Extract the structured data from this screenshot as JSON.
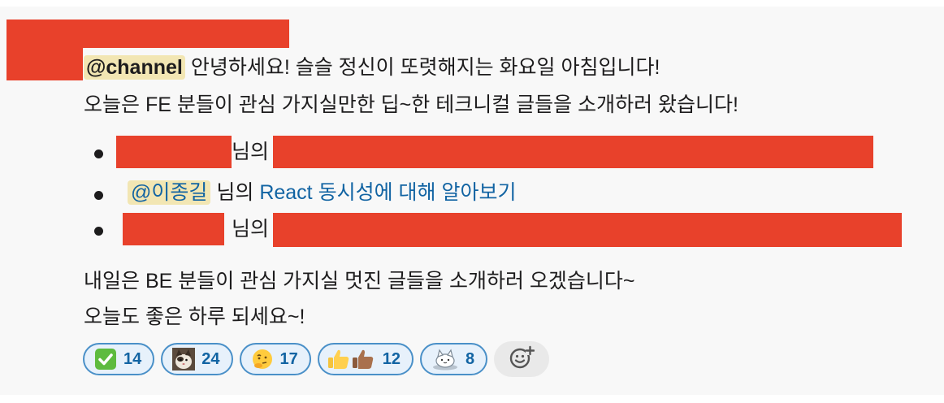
{
  "message": {
    "greeting_mention": "@channel",
    "greeting_text": "안녕하세요! 슬슬 정신이 또렷해지는 화요일 아침입니다!",
    "intro": "오늘은 FE 분들이 관심 가지실만한 딥~한 테크니컬 글들을 소개하러 왔습니다!",
    "items": [
      {
        "suffix": "님의"
      },
      {
        "mention": "@이종길",
        "suffix": "님의",
        "link": "React 동시성에 대해 알아보기"
      },
      {
        "suffix": "님의"
      }
    ],
    "outro1": "내일은 BE 분들이 관심 가지실 멋진 글들을 소개하러 오겠습니다~",
    "outro2": "오늘도 좋은 하루 되세요~!"
  },
  "reactions": [
    {
      "emoji": "white-check-mark",
      "count": "14"
    },
    {
      "emoji": "cat-photo",
      "count": "24"
    },
    {
      "emoji": "thinking-face",
      "count": "17"
    },
    {
      "emoji": "thumbs-up-multi-tone",
      "count": "12"
    },
    {
      "emoji": "cat-mascot",
      "count": "8"
    }
  ],
  "colors": {
    "accent": "#1264a3",
    "redaction": "#e8412b",
    "mention_bg": "#f2e6b3"
  }
}
